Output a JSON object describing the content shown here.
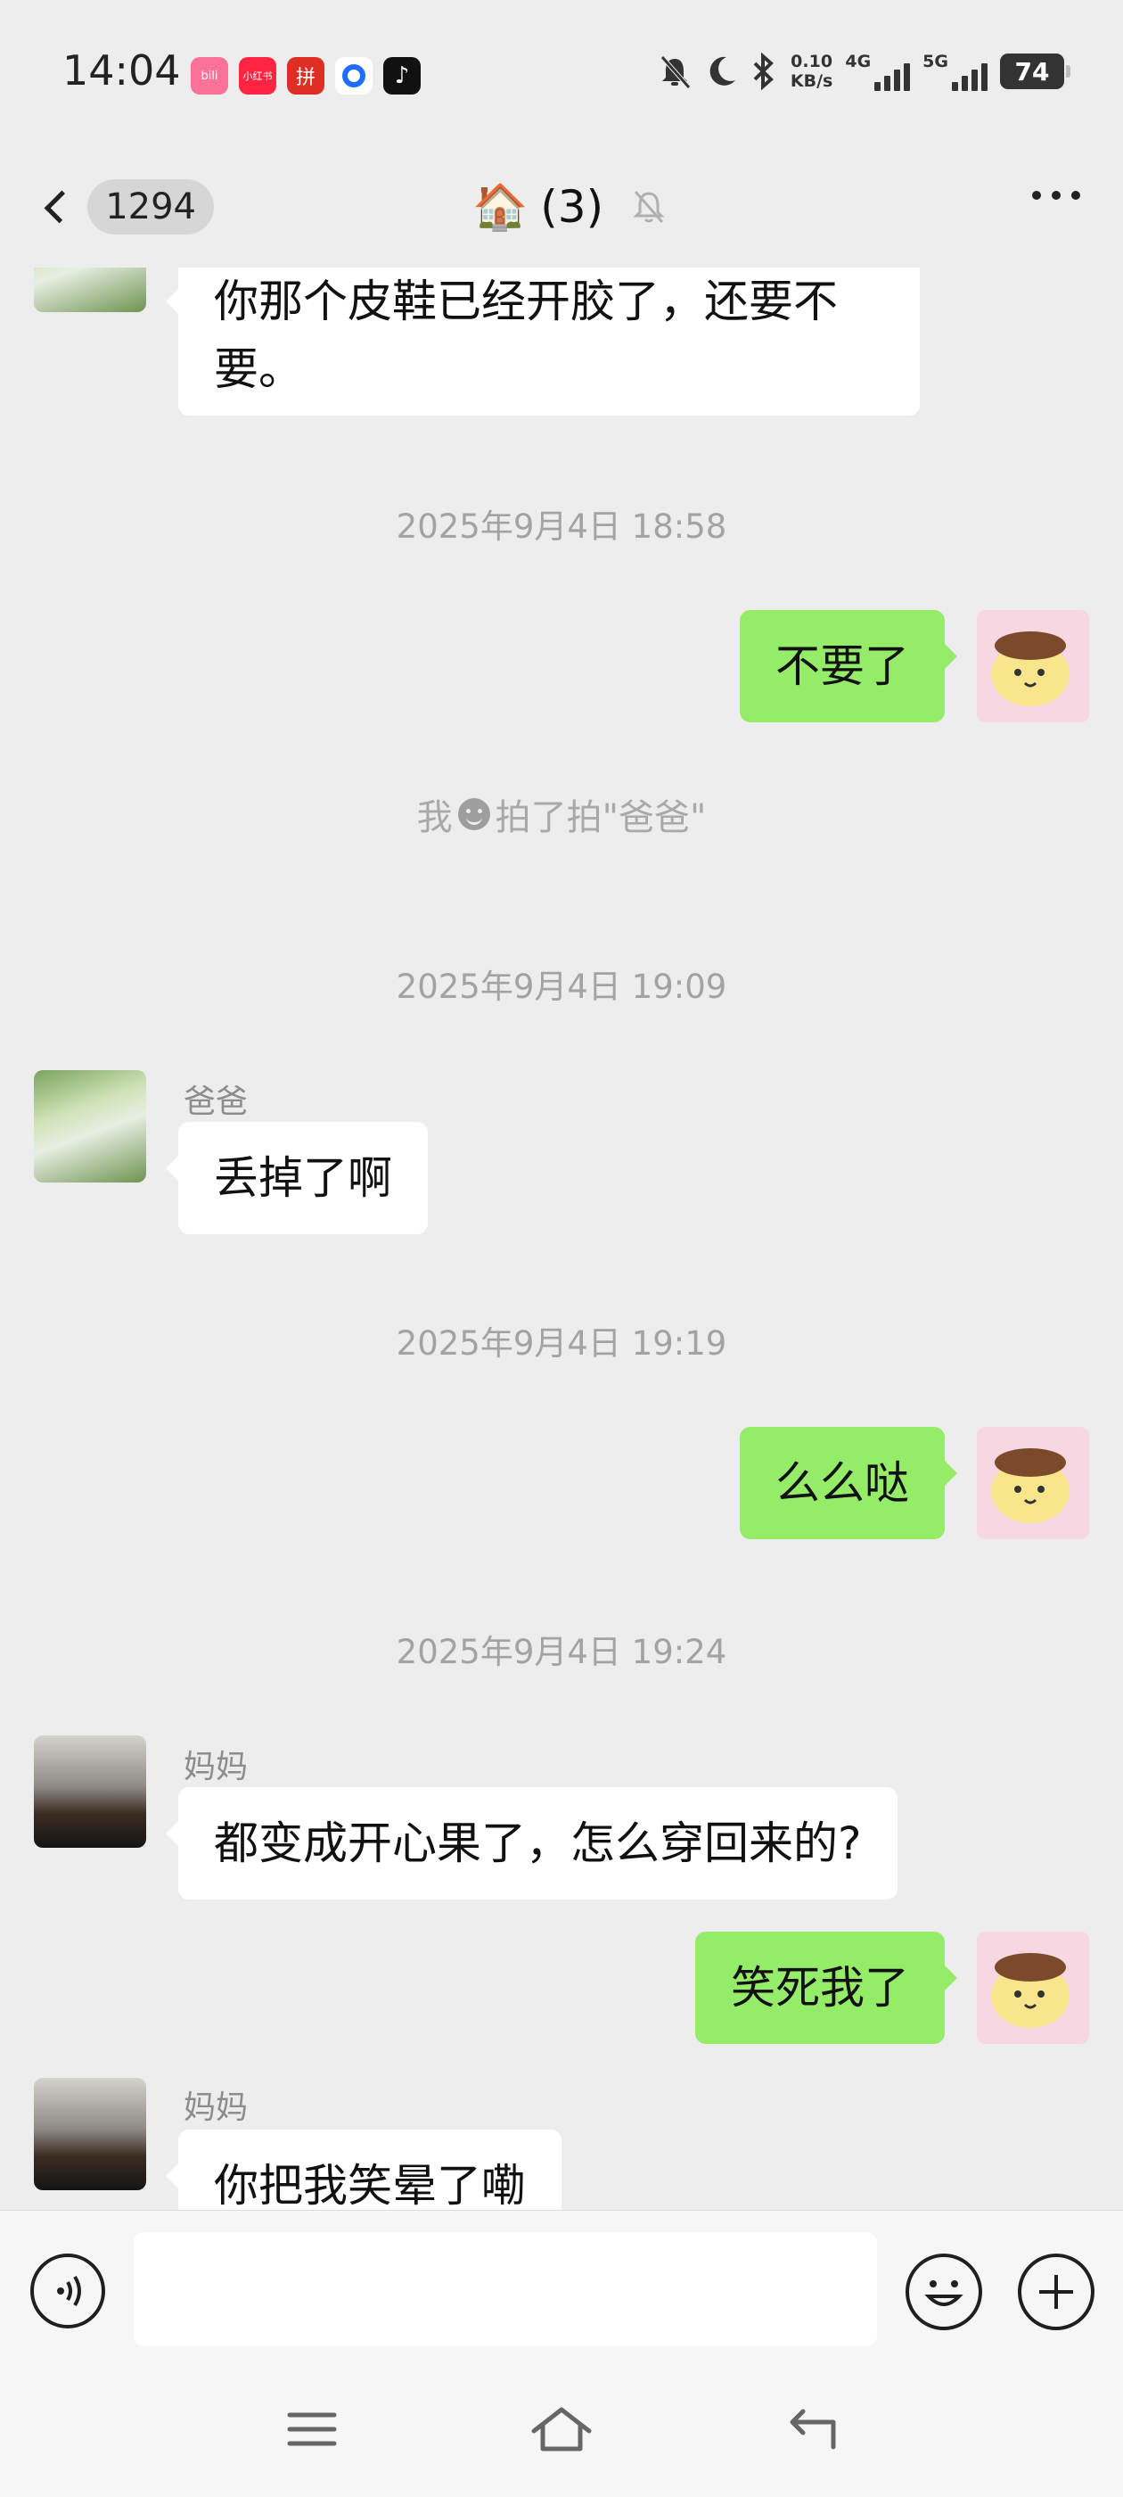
{
  "status_bar": {
    "time": "14:04",
    "apps": [
      {
        "name": "bilibili-app-icon",
        "text": "bili",
        "color": "#fb7299"
      },
      {
        "name": "xiaohongshu-app-icon",
        "text": "小红书",
        "color": "#ff2442"
      },
      {
        "name": "pinduoduo-app-icon",
        "text": "拼",
        "color": "#e02e24"
      },
      {
        "name": "qq-browser-app-icon",
        "text": "",
        "color": "#1e6fff"
      },
      {
        "name": "tiktok-app-icon",
        "text": "♪",
        "color": "#111111"
      }
    ],
    "speed_value": "0.10",
    "speed_unit": "KB/s",
    "net1": "4G",
    "net2": "5G",
    "battery": "74"
  },
  "nav": {
    "unread_count": "1294",
    "title_emoji": "🏠",
    "title_count": "(3)"
  },
  "messages": {
    "m0": {
      "text_line1": "你那个皮鞋已经开胶了，还要不",
      "text_line2": "要。"
    },
    "t1": "2025年9月4日 18:58",
    "m1": "不要了",
    "s1_before": "我",
    "s1_after": "拍了拍\"爸爸\"",
    "t2": "2025年9月4日 19:09",
    "m2_sender": "爸爸",
    "m2": "丢掉了啊",
    "t3": "2025年9月4日 19:19",
    "m3": "么么哒",
    "t4": "2025年9月4日 19:24",
    "m4_sender": "妈妈",
    "m4": "都变成开心果了，怎么穿回来的?",
    "m5": "笑死我了",
    "m6_sender": "妈妈",
    "m6": "你把我笑晕了嘞"
  },
  "input": {
    "placeholder": ""
  }
}
